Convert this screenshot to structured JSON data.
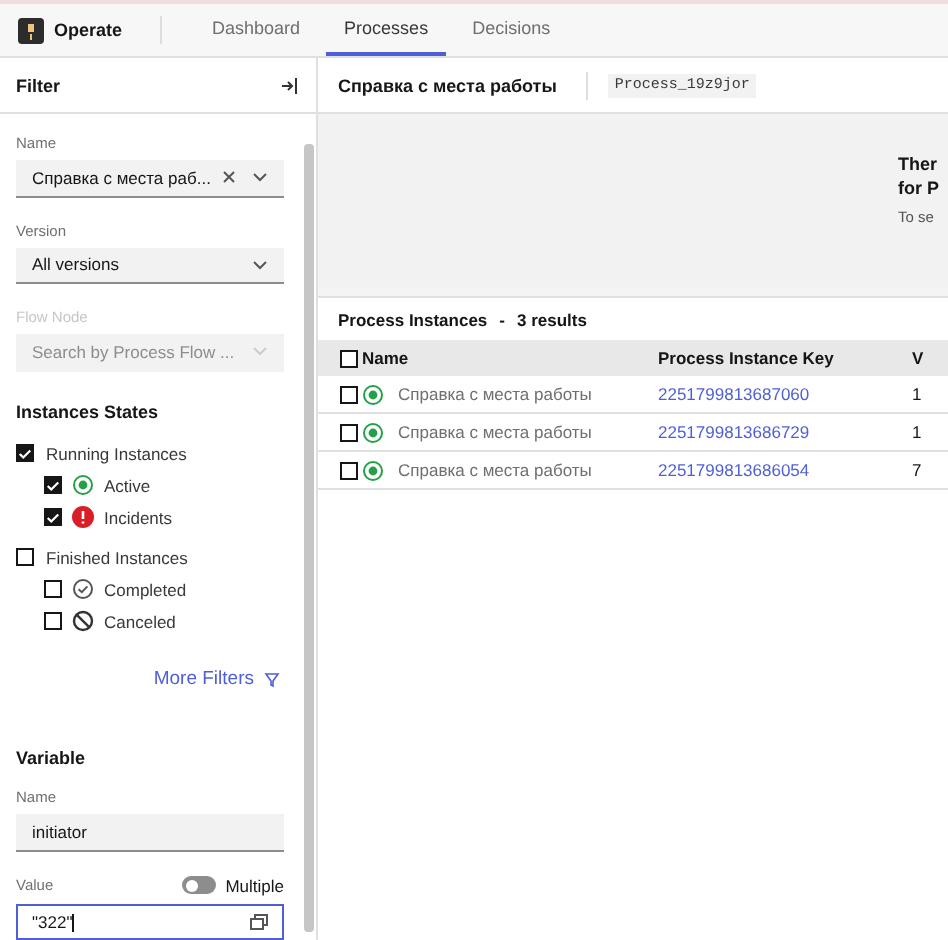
{
  "app": {
    "name": "Operate"
  },
  "nav_tabs": [
    {
      "label": "Dashboard",
      "selected": false
    },
    {
      "label": "Processes",
      "selected": true
    },
    {
      "label": "Decisions",
      "selected": false
    }
  ],
  "filter": {
    "title": "Filter",
    "fields": [
      {
        "label": "Name",
        "value": "Справка с места раб...",
        "clearable": true,
        "disabled": false
      },
      {
        "label": "Version",
        "value": "All versions",
        "clearable": false,
        "disabled": false
      },
      {
        "label": "Flow Node",
        "placeholder": "Search by Process Flow ...",
        "clearable": false,
        "disabled": true
      }
    ],
    "states_title": "Instances States",
    "state_groups": [
      {
        "label": "Running Instances",
        "checked": true,
        "children": [
          {
            "label": "Active",
            "checked": true,
            "kind": "active"
          },
          {
            "label": "Incidents",
            "checked": true,
            "kind": "incident"
          }
        ]
      },
      {
        "label": "Finished Instances",
        "checked": false,
        "children": [
          {
            "label": "Completed",
            "checked": false,
            "kind": "completed"
          },
          {
            "label": "Canceled",
            "checked": false,
            "kind": "canceled"
          }
        ]
      }
    ],
    "more_filters": "More Filters",
    "variable": {
      "title": "Variable",
      "name_label": "Name",
      "name_value": "initiator",
      "value_label": "Value",
      "multiple_label": "Multiple",
      "multiple_on": false,
      "value": "\"322\"",
      "focused": true
    }
  },
  "process": {
    "title": "Справка с места работы",
    "id": "Process_19z9jor",
    "message": {
      "heading_lines": [
        "Ther",
        "for P"
      ],
      "text": "To se"
    }
  },
  "instances": {
    "title": "Process Instances",
    "separator": "-",
    "count": "3 results",
    "select_all_checked": false,
    "columns": [
      "Name",
      "Process Instance Key",
      "V"
    ],
    "rows": [
      {
        "name": "Справка с места работы",
        "key": "2251799813687060",
        "column_3": "1",
        "selected": false
      },
      {
        "name": "Справка с места работы",
        "key": "2251799813686729",
        "column_3": "1",
        "selected": false
      },
      {
        "name": "Справка с места работы",
        "key": "2251799813686054",
        "column_3": "7",
        "selected": false
      }
    ]
  }
}
